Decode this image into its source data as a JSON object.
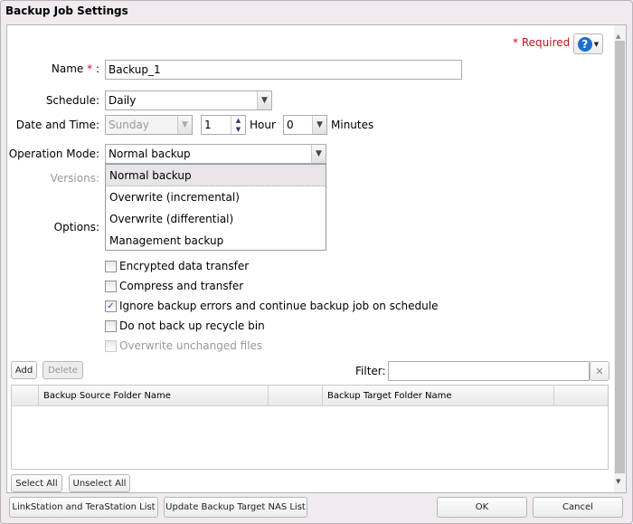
{
  "window": {
    "title": "Backup Job Settings"
  },
  "header": {
    "required_star": "*",
    "required_label": "Required",
    "help_icon": "question-icon"
  },
  "form": {
    "name_label": "Name",
    "name_star": "*",
    "name_colon": ":",
    "name_value": "Backup_1",
    "schedule_label": "Schedule:",
    "schedule_value": "Daily",
    "datetime_label": "Date and Time:",
    "day_value": "Sunday",
    "hour_value": "1",
    "hour_label": "Hour",
    "minutes_value": "0",
    "minutes_label": "Minutes",
    "opmode_label": "Operation Mode:",
    "opmode_value": "Normal backup",
    "versions_label": "Versions:",
    "options_label": "Options:"
  },
  "dropdown": {
    "options": [
      "Normal backup",
      "Overwrite (incremental)",
      "Overwrite (differential)",
      "Management backup"
    ],
    "selected": "Normal backup"
  },
  "options": [
    {
      "label": "Encrypted data transfer",
      "checked": false,
      "disabled": false
    },
    {
      "label": "Compress and transfer",
      "checked": false,
      "disabled": false
    },
    {
      "label": "Ignore backup errors and continue backup job on schedule",
      "checked": true,
      "disabled": false
    },
    {
      "label": "Do not back up recycle bin",
      "checked": false,
      "disabled": false
    },
    {
      "label": "Overwrite unchanged files",
      "checked": false,
      "disabled": true
    }
  ],
  "toolbar": {
    "add": "Add",
    "delete": "Delete",
    "filter_label": "Filter:",
    "filter_value": "",
    "clear": "✕"
  },
  "table": {
    "columns": [
      "",
      "Backup Source Folder Name",
      "",
      "Backup Target Folder Name",
      ""
    ],
    "rows": []
  },
  "selection": {
    "select_all": "Select All",
    "unselect_all": "Unselect All"
  },
  "footer": {
    "list": "LinkStation and TeraStation List",
    "update": "Update Backup Target NAS List",
    "ok": "OK",
    "cancel": "Cancel"
  },
  "colors": {
    "required": "#c0141c",
    "help": "#1a6fd0"
  }
}
